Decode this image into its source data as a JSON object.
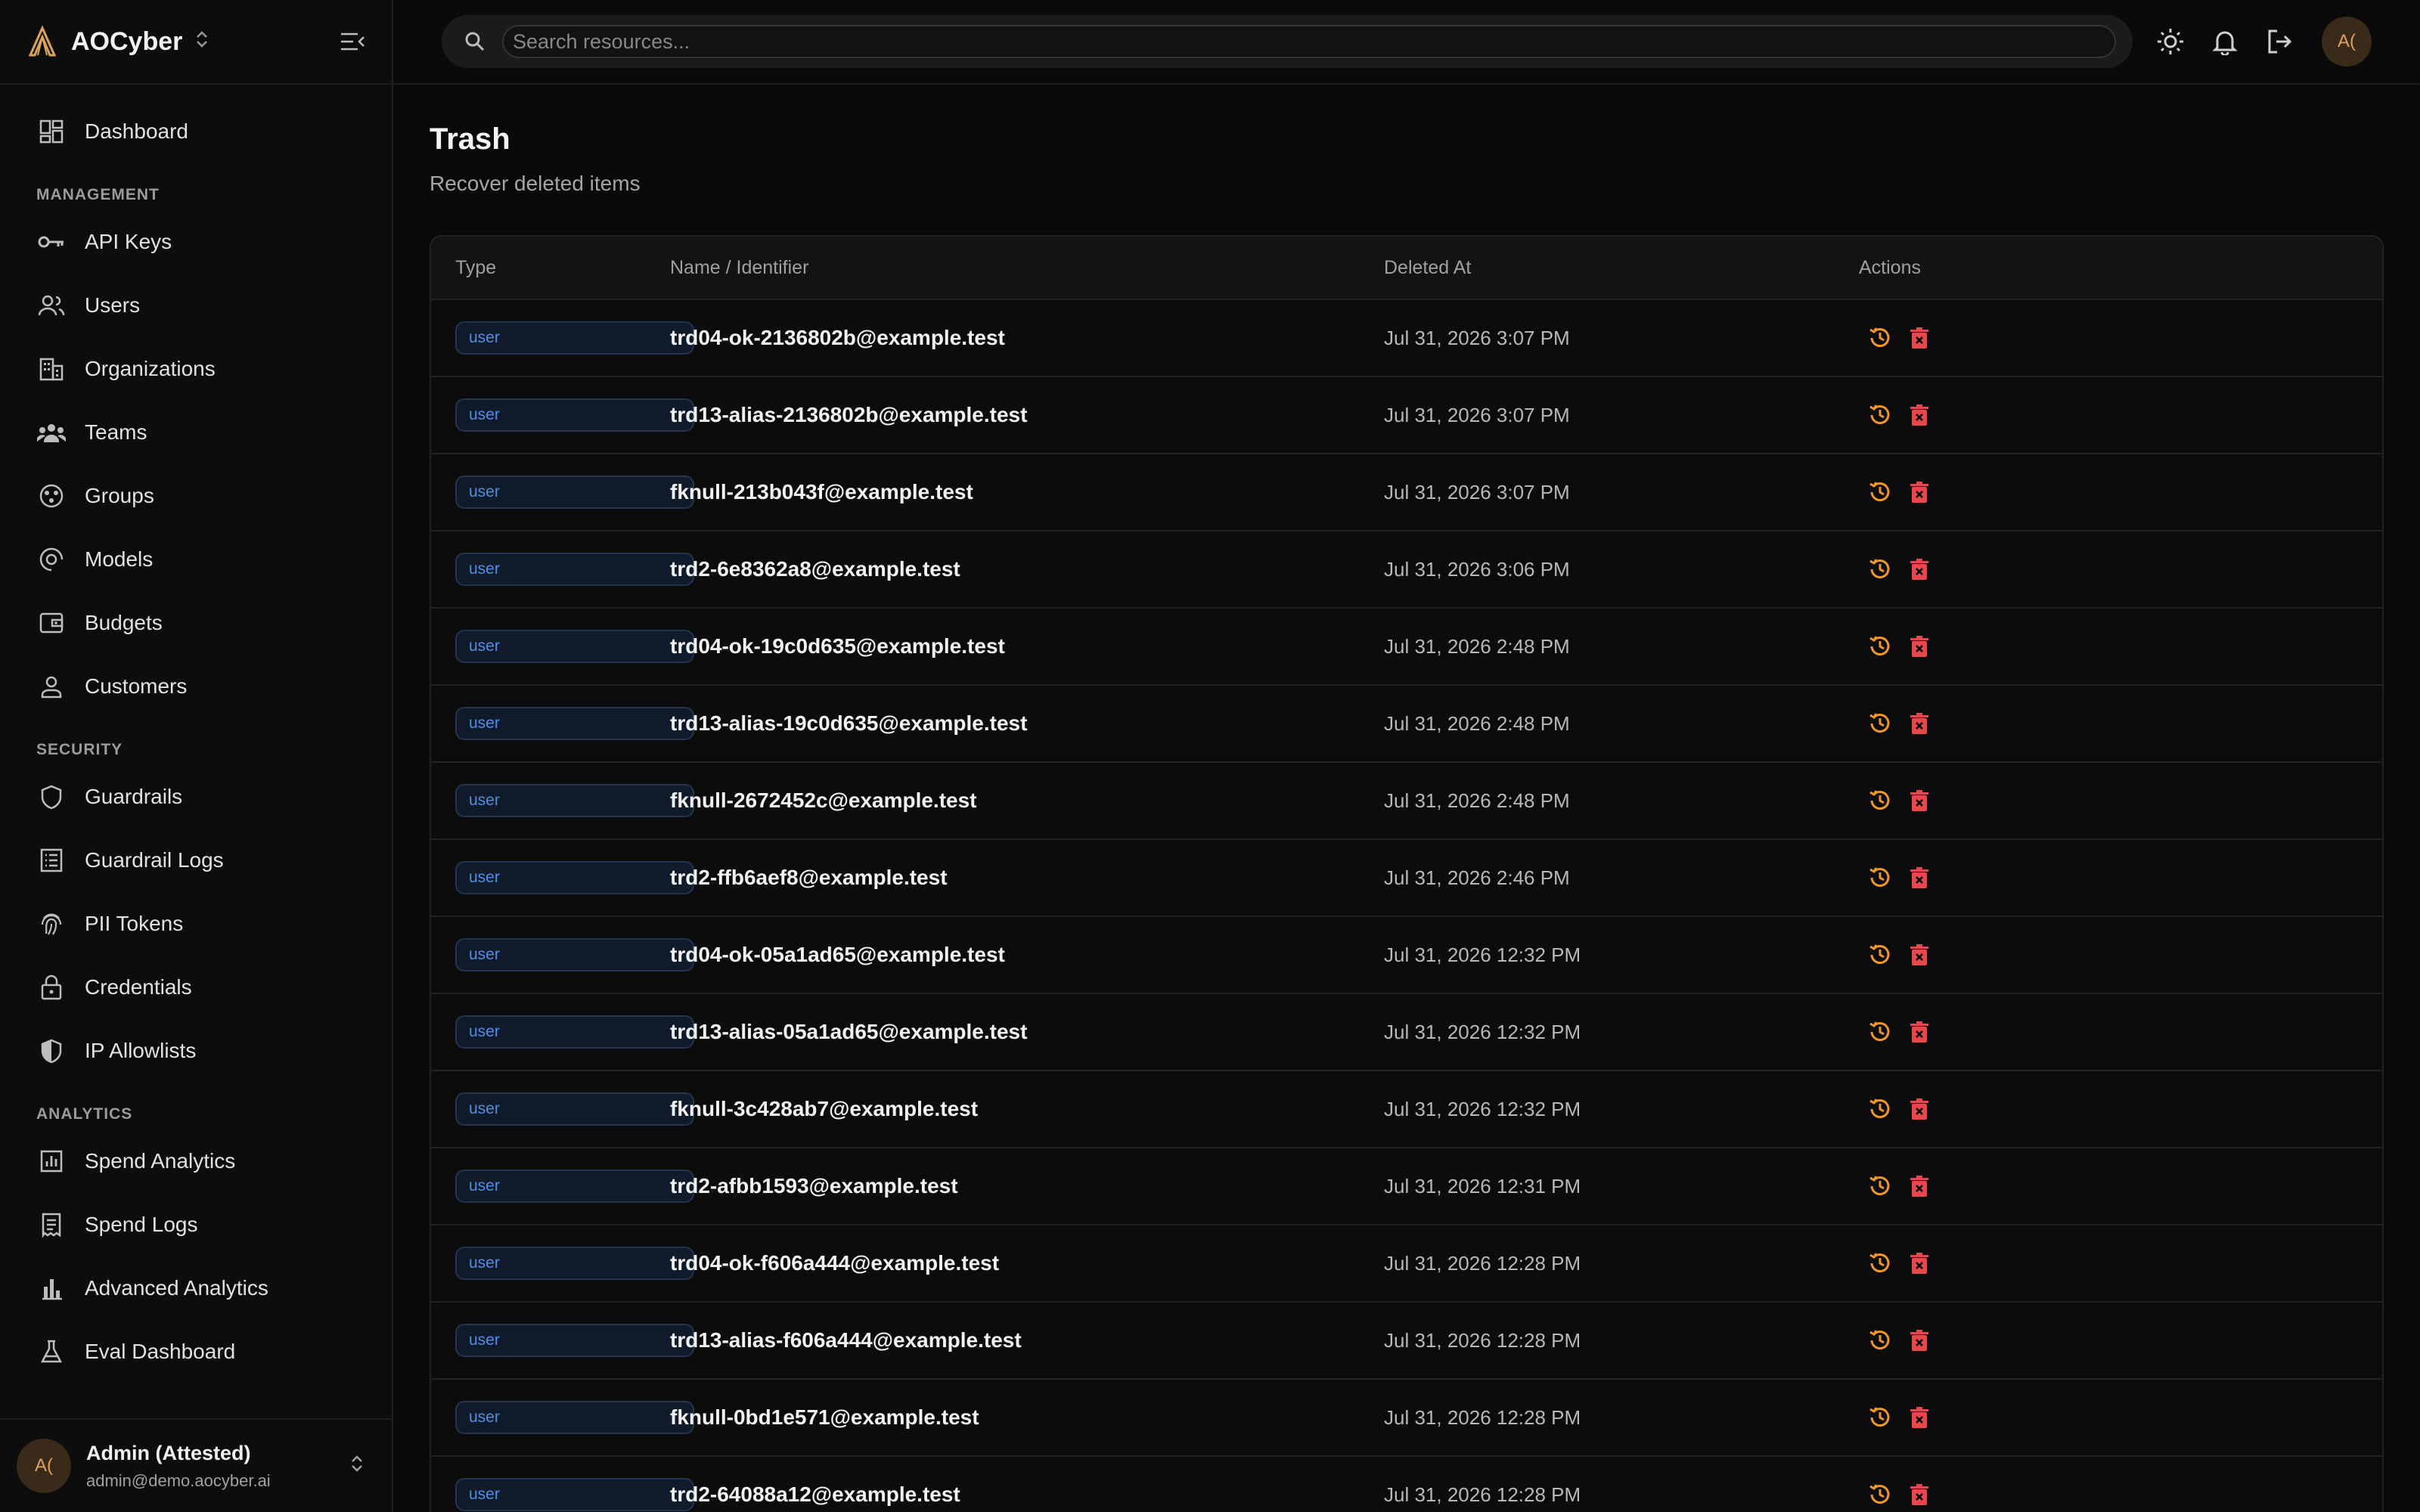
{
  "app": {
    "name": "AOCyber"
  },
  "search": {
    "placeholder": "Search resources..."
  },
  "sidebar": {
    "top_items": [
      {
        "label": "Dashboard",
        "icon": "dashboard-icon"
      }
    ],
    "sections": [
      {
        "title": "MANAGEMENT",
        "items": [
          {
            "label": "API Keys",
            "icon": "key-icon"
          },
          {
            "label": "Users",
            "icon": "users-icon"
          },
          {
            "label": "Organizations",
            "icon": "building-icon"
          },
          {
            "label": "Teams",
            "icon": "teams-icon"
          },
          {
            "label": "Groups",
            "icon": "groups-icon"
          },
          {
            "label": "Models",
            "icon": "models-icon"
          },
          {
            "label": "Budgets",
            "icon": "wallet-icon"
          },
          {
            "label": "Customers",
            "icon": "customer-icon"
          }
        ]
      },
      {
        "title": "SECURITY",
        "items": [
          {
            "label": "Guardrails",
            "icon": "shield-icon"
          },
          {
            "label": "Guardrail Logs",
            "icon": "log-list-icon"
          },
          {
            "label": "PII Tokens",
            "icon": "fingerprint-icon"
          },
          {
            "label": "Credentials",
            "icon": "lock-icon"
          },
          {
            "label": "IP Allowlists",
            "icon": "shield-half-icon"
          }
        ]
      },
      {
        "title": "ANALYTICS",
        "items": [
          {
            "label": "Spend Analytics",
            "icon": "analytics-icon"
          },
          {
            "label": "Spend Logs",
            "icon": "receipt-icon"
          },
          {
            "label": "Advanced Analytics",
            "icon": "bar-chart-icon"
          },
          {
            "label": "Eval Dashboard",
            "icon": "flask-icon"
          }
        ]
      }
    ],
    "footer": {
      "avatar": "A(",
      "name": "Admin (Attested)",
      "email": "admin@demo.aocyber.ai"
    }
  },
  "topbar": {
    "avatar": "A("
  },
  "page": {
    "title": "Trash",
    "subtitle": "Recover deleted items"
  },
  "table": {
    "headers": {
      "type": "Type",
      "name": "Name / Identifier",
      "deleted_at": "Deleted At",
      "actions": "Actions"
    },
    "rows": [
      {
        "type": "user",
        "name": "trd04-ok-2136802b@example.test",
        "deleted_at": "Jul 31, 2026 3:07 PM"
      },
      {
        "type": "user",
        "name": "trd13-alias-2136802b@example.test",
        "deleted_at": "Jul 31, 2026 3:07 PM"
      },
      {
        "type": "user",
        "name": "fknull-213b043f@example.test",
        "deleted_at": "Jul 31, 2026 3:07 PM"
      },
      {
        "type": "user",
        "name": "trd2-6e8362a8@example.test",
        "deleted_at": "Jul 31, 2026 3:06 PM"
      },
      {
        "type": "user",
        "name": "trd04-ok-19c0d635@example.test",
        "deleted_at": "Jul 31, 2026 2:48 PM"
      },
      {
        "type": "user",
        "name": "trd13-alias-19c0d635@example.test",
        "deleted_at": "Jul 31, 2026 2:48 PM"
      },
      {
        "type": "user",
        "name": "fknull-2672452c@example.test",
        "deleted_at": "Jul 31, 2026 2:48 PM"
      },
      {
        "type": "user",
        "name": "trd2-ffb6aef8@example.test",
        "deleted_at": "Jul 31, 2026 2:46 PM"
      },
      {
        "type": "user",
        "name": "trd04-ok-05a1ad65@example.test",
        "deleted_at": "Jul 31, 2026 12:32 PM"
      },
      {
        "type": "user",
        "name": "trd13-alias-05a1ad65@example.test",
        "deleted_at": "Jul 31, 2026 12:32 PM"
      },
      {
        "type": "user",
        "name": "fknull-3c428ab7@example.test",
        "deleted_at": "Jul 31, 2026 12:32 PM"
      },
      {
        "type": "user",
        "name": "trd2-afbb1593@example.test",
        "deleted_at": "Jul 31, 2026 12:31 PM"
      },
      {
        "type": "user",
        "name": "trd04-ok-f606a444@example.test",
        "deleted_at": "Jul 31, 2026 12:28 PM"
      },
      {
        "type": "user",
        "name": "trd13-alias-f606a444@example.test",
        "deleted_at": "Jul 31, 2026 12:28 PM"
      },
      {
        "type": "user",
        "name": "fknull-0bd1e571@example.test",
        "deleted_at": "Jul 31, 2026 12:28 PM"
      },
      {
        "type": "user",
        "name": "trd2-64088a12@example.test",
        "deleted_at": "Jul 31, 2026 12:28 PM"
      }
    ]
  },
  "colors": {
    "restore": "#f0962a",
    "delete": "#e5484d",
    "badge_text": "#4f8fe6",
    "accent": "#e0a060"
  }
}
